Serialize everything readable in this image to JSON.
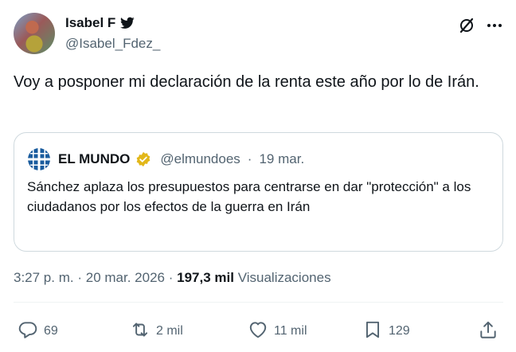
{
  "author": {
    "display_name": "Isabel F",
    "handle": "@Isabel_Fdez_"
  },
  "tweet": {
    "text": "Voy a posponer mi declaración de la renta este año por lo de Irán."
  },
  "quote": {
    "display_name": "EL MUNDO",
    "handle": "@elmundoes",
    "separator": "·",
    "date": "19 mar.",
    "text": "Sánchez aplaza los presupuestos para centrarse en dar \"protección\" a los ciudadanos por los efectos de la guerra en Irán"
  },
  "meta": {
    "time": "3:27 p. m.",
    "separator1": "·",
    "date": "20 mar. 2026",
    "separator2": "·",
    "views_count": "197,3 mil",
    "views_label": "Visualizaciones"
  },
  "actions": {
    "replies": "69",
    "reposts": "2 mil",
    "likes": "11 mil",
    "bookmarks": "129"
  },
  "icons": {
    "header": [
      "bird-icon",
      "grok-icon",
      "more-icon"
    ],
    "quote": [
      "el-mundo-logo",
      "verified-gold-icon"
    ],
    "actions": [
      "reply-icon",
      "repost-icon",
      "like-icon",
      "bookmark-icon",
      "share-icon"
    ]
  },
  "colors": {
    "text": "#0f1419",
    "secondary": "#536471",
    "border": "#cfd9de",
    "verified_gold": "#e2b719",
    "el_mundo_blue": "#1a5c9e"
  }
}
